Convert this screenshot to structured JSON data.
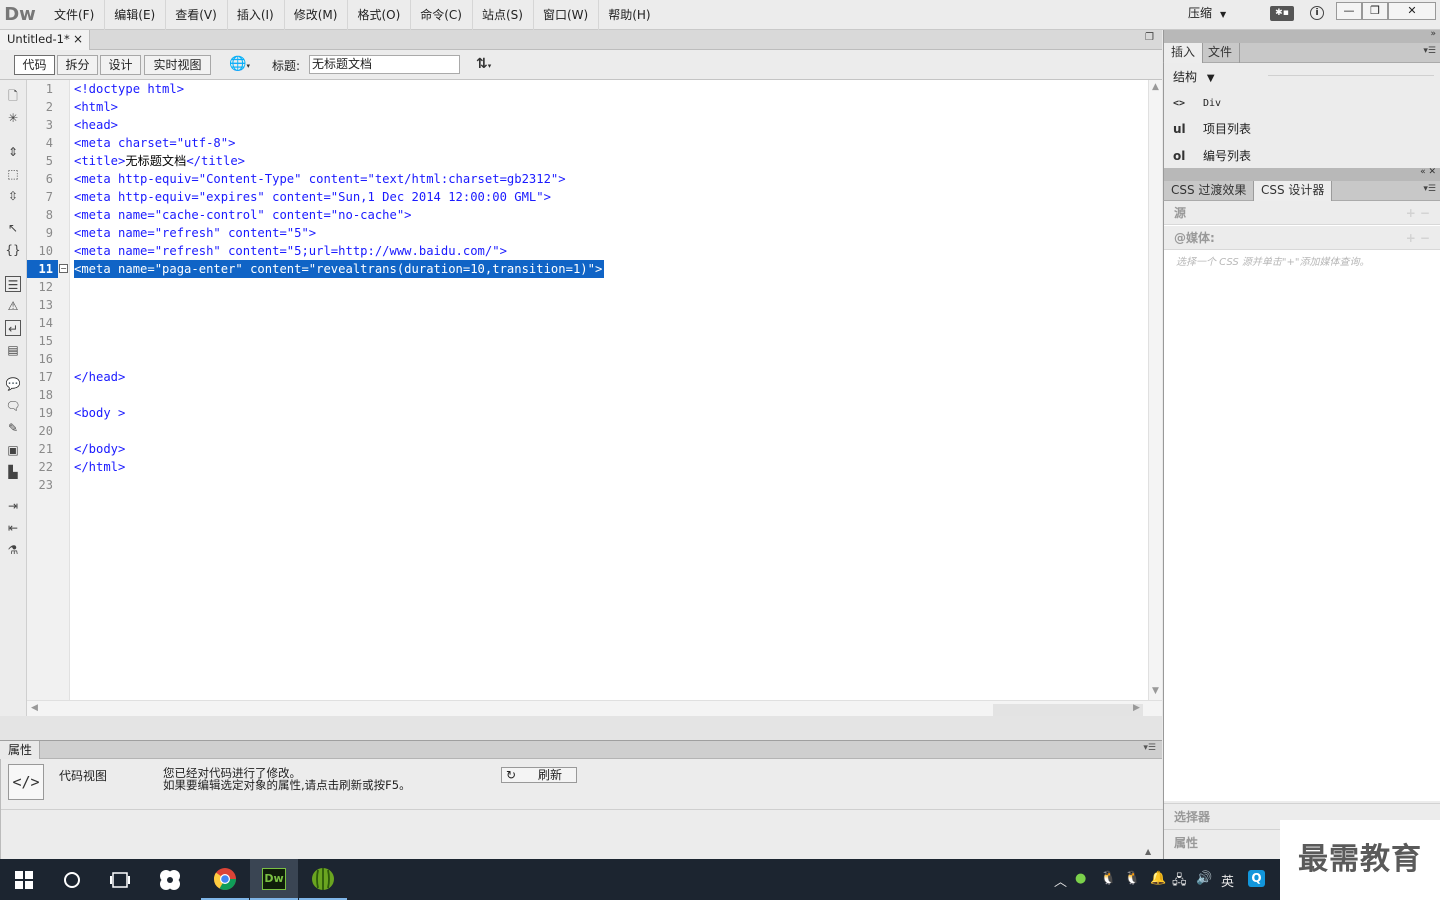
{
  "app": {
    "logo": "Dw",
    "menus": [
      "文件(F)",
      "编辑(E)",
      "查看(V)",
      "插入(I)",
      "修改(M)",
      "格式(O)",
      "命令(C)",
      "站点(S)",
      "窗口(W)",
      "帮助(H)"
    ],
    "workspace": "压缩",
    "window_controls": {
      "minimize": "—",
      "restore": "❐",
      "close": "✕"
    }
  },
  "document": {
    "tab_title": "Untitled-1*",
    "tab_close": "×",
    "views": [
      "代码",
      "拆分",
      "设计",
      "实时视图"
    ],
    "active_view": "代码",
    "title_label": "标题:",
    "title_value": "无标题文档"
  },
  "code": {
    "current_line": 11,
    "lines": [
      {
        "n": "1",
        "t": "<!doctype html>"
      },
      {
        "n": "2",
        "t": "<html>"
      },
      {
        "n": "3",
        "t": "<head>"
      },
      {
        "n": "4",
        "t": "<meta charset=\"utf-8\">"
      },
      {
        "n": "5",
        "t": "<title>",
        "zh": "无标题文档",
        "t2": "</title>"
      },
      {
        "n": "6",
        "t": "<meta http-equiv=\"Content-Type\" content=\"text/html:charset=gb2312\">"
      },
      {
        "n": "7",
        "t": "<meta http-equiv=\"expires\" content=\"Sun,1 Dec 2014 12:00:00 GML\">"
      },
      {
        "n": "8",
        "t": "<meta name=\"cache-control\" content=\"no-cache\">"
      },
      {
        "n": "9",
        "t": "<meta name=\"refresh\" content=\"5\">"
      },
      {
        "n": "10",
        "t": "<meta name=\"refresh\" content=\"5;url=http://www.baidu.com/\">"
      },
      {
        "n": "11",
        "t": "<meta name=\"paga-enter\" content=\"revealtrans(duration=10,transition=1)\">"
      },
      {
        "n": "12",
        "t": ""
      },
      {
        "n": "13",
        "t": ""
      },
      {
        "n": "14",
        "t": ""
      },
      {
        "n": "15",
        "t": ""
      },
      {
        "n": "16",
        "t": ""
      },
      {
        "n": "17",
        "t": "</head>"
      },
      {
        "n": "18",
        "t": ""
      },
      {
        "n": "19",
        "t": "<body >"
      },
      {
        "n": "20",
        "t": ""
      },
      {
        "n": "21",
        "t": "</body>"
      },
      {
        "n": "22",
        "t": "</html>"
      },
      {
        "n": "23",
        "t": ""
      }
    ]
  },
  "properties": {
    "tab": "属性",
    "view_label": "代码视图",
    "message_line1": "您已经对代码进行了修改。",
    "message_line2": "如果要编辑选定对象的属性,请点击刷新或按F5。",
    "refresh_label": "刷新"
  },
  "insert_panel": {
    "tabs": [
      "插入",
      "文件"
    ],
    "category": "结构",
    "items": [
      {
        "icon": "<>",
        "label": "Div"
      },
      {
        "icon": "ul",
        "label": "项目列表"
      },
      {
        "icon": "ol",
        "label": "编号列表"
      }
    ]
  },
  "css_panel": {
    "tabs": [
      "CSS 过渡效果",
      "CSS 设计器"
    ],
    "source_label": "源",
    "media_label": "@媒体:",
    "media_hint": "选择一个 CSS 源并单击\"+\"添加媒体查询。",
    "selectors_label": "选择器",
    "properties_label": "属性"
  },
  "watermark": "最需教育",
  "taskbar": {
    "ime": "英",
    "apps": [
      "windows-start",
      "cortana-search",
      "task-view",
      "app-swirl",
      "chrome",
      "dreamweaver",
      "watermelon-app"
    ]
  }
}
